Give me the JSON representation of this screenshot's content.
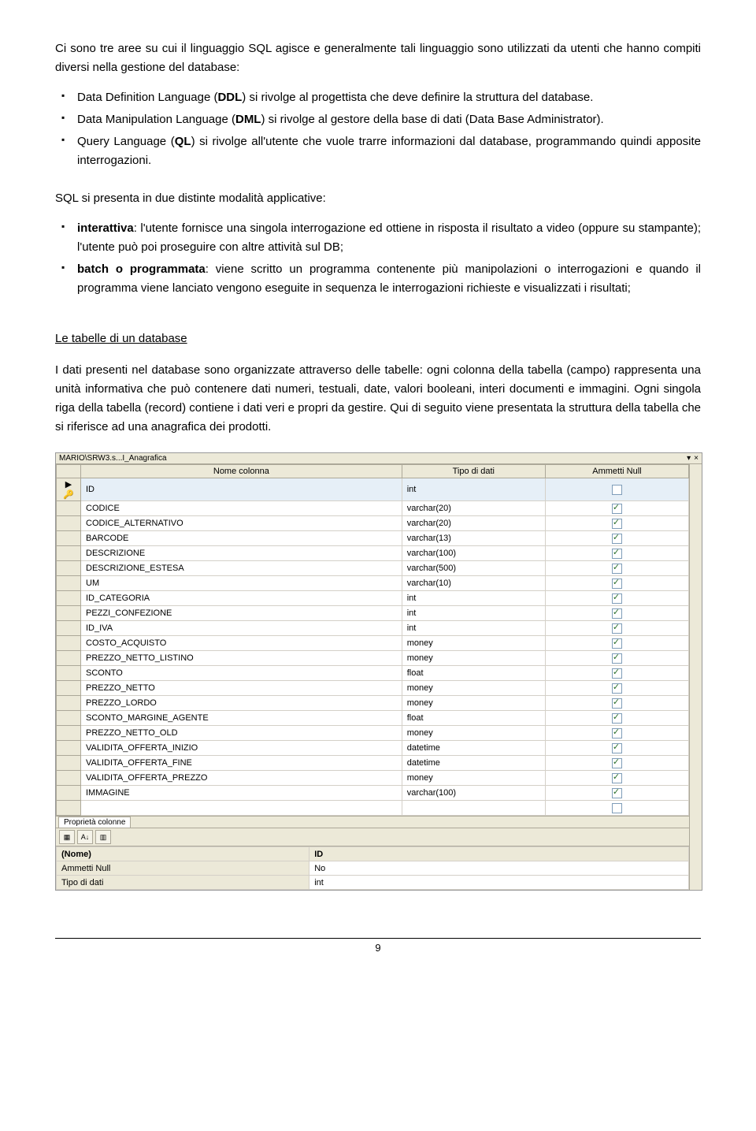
{
  "intro": "Ci sono tre aree su cui il linguaggio SQL agisce e generalmente tali linguaggio sono utilizzati da utenti che hanno compiti diversi nella gestione del database:",
  "bullets1": [
    {
      "pre": "Data Definition Language (",
      "bold": "DDL",
      "post": ") si rivolge al progettista che deve definire la struttura del database."
    },
    {
      "pre": "Data Manipulation Language (",
      "bold": "DML",
      "post": ")  si rivolge al gestore della base di dati (Data Base Administrator)."
    },
    {
      "pre": "Query Language (",
      "bold": "QL",
      "post": ") si rivolge all'utente che vuole trarre informazioni dal database, programmando quindi apposite interrogazioni."
    }
  ],
  "para2": "SQL si presenta in due distinte modalità applicative:",
  "bullets2": [
    {
      "bold": "interattiva",
      "post": ": l'utente fornisce una singola interrogazione ed ottiene in risposta il risultato a video (oppure su stampante); l'utente può poi proseguire con altre attività sul DB;"
    },
    {
      "bold": "batch o programmata",
      "post": ": viene scritto un programma contenente più manipolazioni o interrogazioni e quando il programma viene lanciato vengono eseguite in sequenza le interrogazioni richieste e visualizzati i risultati;"
    }
  ],
  "heading": "Le tabelle di un database",
  "para3": "I dati presenti nel database sono organizzate attraverso delle tabelle: ogni colonna della tabella (campo) rappresenta una unità informativa che può contenere dati numeri, testuali, date, valori booleani, interi documenti e immagini. Ogni singola riga della tabella (record) contiene i dati veri e propri da gestire. Qui di seguito viene presentata la struttura della tabella che si riferisce ad una anagrafica dei prodotti.",
  "db": {
    "title": "MARIO\\SRW3.s...I_Anagrafica",
    "headers": [
      "Nome colonna",
      "Tipo di dati",
      "Ammetti Null"
    ],
    "rows": [
      {
        "key": true,
        "name": "ID",
        "type": "int",
        "null": false
      },
      {
        "name": "CODICE",
        "type": "varchar(20)",
        "null": true
      },
      {
        "name": "CODICE_ALTERNATIVO",
        "type": "varchar(20)",
        "null": true
      },
      {
        "name": "BARCODE",
        "type": "varchar(13)",
        "null": true
      },
      {
        "name": "DESCRIZIONE",
        "type": "varchar(100)",
        "null": true
      },
      {
        "name": "DESCRIZIONE_ESTESA",
        "type": "varchar(500)",
        "null": true
      },
      {
        "name": "UM",
        "type": "varchar(10)",
        "null": true
      },
      {
        "name": "ID_CATEGORIA",
        "type": "int",
        "null": true
      },
      {
        "name": "PEZZI_CONFEZIONE",
        "type": "int",
        "null": true
      },
      {
        "name": "ID_IVA",
        "type": "int",
        "null": true
      },
      {
        "name": "COSTO_ACQUISTO",
        "type": "money",
        "null": true
      },
      {
        "name": "PREZZO_NETTO_LISTINO",
        "type": "money",
        "null": true
      },
      {
        "name": "SCONTO",
        "type": "float",
        "null": true
      },
      {
        "name": "PREZZO_NETTO",
        "type": "money",
        "null": true
      },
      {
        "name": "PREZZO_LORDO",
        "type": "money",
        "null": true
      },
      {
        "name": "SCONTO_MARGINE_AGENTE",
        "type": "float",
        "null": true
      },
      {
        "name": "PREZZO_NETTO_OLD",
        "type": "money",
        "null": true
      },
      {
        "name": "VALIDITA_OFFERTA_INIZIO",
        "type": "datetime",
        "null": true
      },
      {
        "name": "VALIDITA_OFFERTA_FINE",
        "type": "datetime",
        "null": true
      },
      {
        "name": "VALIDITA_OFFERTA_PREZZO",
        "type": "money",
        "null": true
      },
      {
        "name": "IMMAGINE",
        "type": "varchar(100)",
        "null": true
      }
    ],
    "propTab": "Proprietà colonne",
    "props": [
      {
        "label": "(Nome)",
        "value": "ID"
      },
      {
        "label": "Ammetti Null",
        "value": "No"
      },
      {
        "label": "Tipo di dati",
        "value": "int"
      }
    ]
  },
  "pageNumber": "9"
}
